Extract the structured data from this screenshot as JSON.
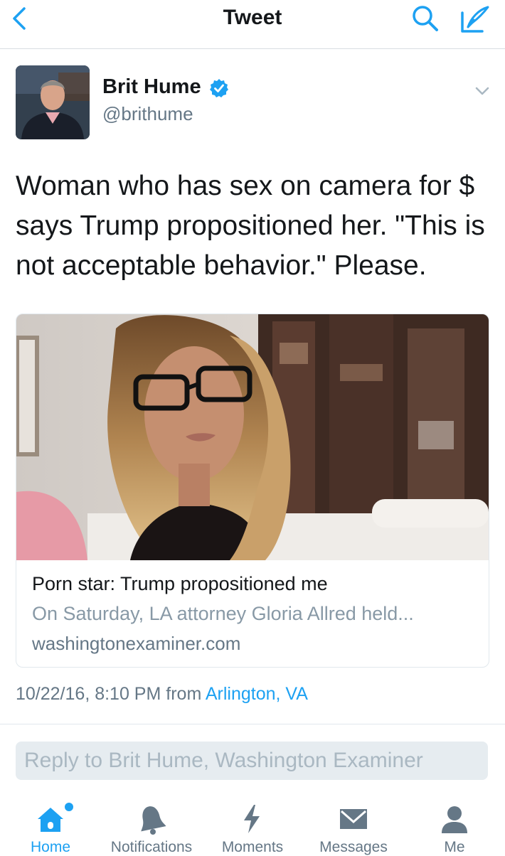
{
  "nav": {
    "title": "Tweet",
    "back_icon": "chevron-left-icon",
    "search_icon": "search-icon",
    "compose_icon": "compose-icon"
  },
  "tweet": {
    "author": {
      "name": "Brit Hume",
      "handle": "@brithume",
      "verified": true
    },
    "text": "Woman who has sex on camera for $ says Trump propositioned her. \"This is not acceptable behavior.\" Please.",
    "card": {
      "title": "Porn star: Trump propositioned me",
      "description": "On Saturday, LA attorney Gloria Allred held...",
      "domain": "washingtonexaminer.com"
    },
    "timestamp": "10/22/16, 8:10 PM",
    "from_label": "from",
    "location": "Arlington, VA"
  },
  "reply": {
    "placeholder": "Reply to Brit Hume, Washington Examiner"
  },
  "tabs": [
    {
      "label": "Home",
      "icon": "home-icon",
      "active": true,
      "notification_dot": true
    },
    {
      "label": "Notifications",
      "icon": "bell-icon",
      "active": false
    },
    {
      "label": "Moments",
      "icon": "lightning-icon",
      "active": false
    },
    {
      "label": "Messages",
      "icon": "envelope-icon",
      "active": false
    },
    {
      "label": "Me",
      "icon": "person-icon",
      "active": false
    }
  ],
  "colors": {
    "accent": "#1da1f2",
    "text": "#14171a",
    "secondary": "#657786",
    "muted": "#8899a6",
    "verified": "#1da1f2"
  }
}
